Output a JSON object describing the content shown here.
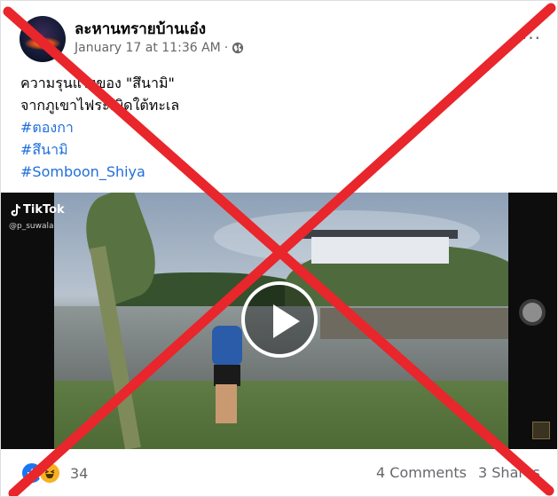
{
  "post": {
    "page_name": "ละหานทรายบ้านเอ๋ง",
    "timestamp": "January 17 at 11:36 AM",
    "separator": "·",
    "privacy_icon": "globe-icon",
    "more_label": "···",
    "caption_lines": [
      "ความรุนแรงของ \"สึนามิ\"",
      "จากภูเขาไฟระเบิดใต้ทะเล"
    ],
    "hashtags": [
      "#ตองกา",
      "#สึนามิ",
      "#Somboon_Shiya"
    ]
  },
  "video": {
    "watermark_brand": "TikTok",
    "watermark_user": "@p_suwala",
    "play_icon": "play-icon"
  },
  "footer": {
    "reaction_icons": [
      "like-icon",
      "haha-icon"
    ],
    "reaction_count": "34",
    "comments": "4 Comments",
    "shares": "3 Shares"
  },
  "overlay": {
    "cross_color": "#e8262b"
  }
}
